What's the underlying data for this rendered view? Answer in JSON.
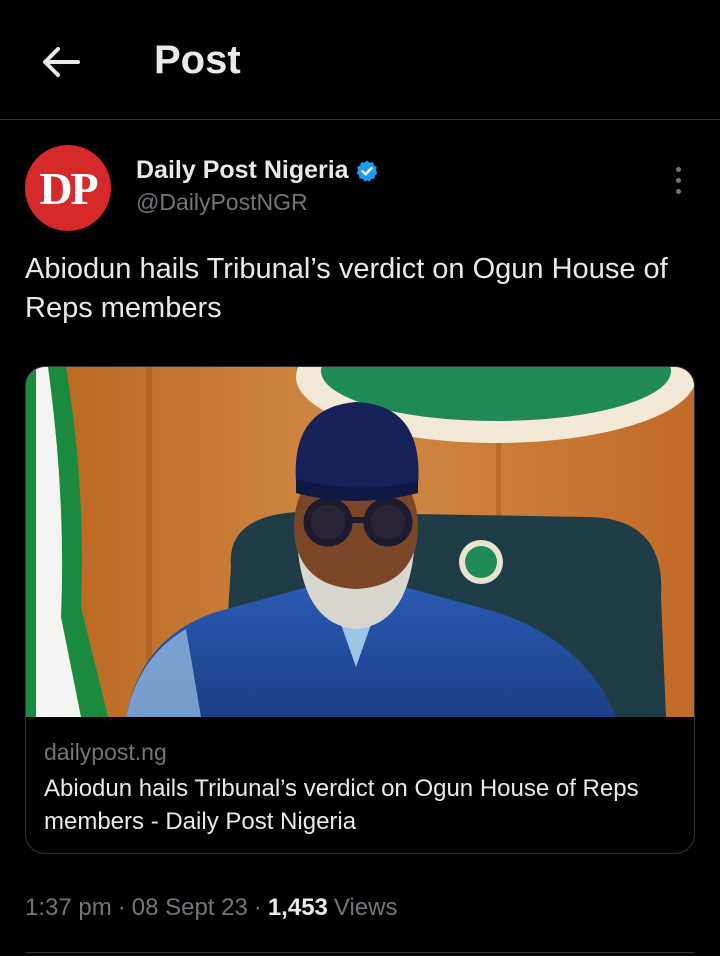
{
  "header": {
    "title": "Post",
    "back_icon": "arrow-left-icon"
  },
  "author": {
    "avatar_text": "DP",
    "avatar_color": "#d62a2a",
    "name": "Daily Post Nigeria",
    "handle": "@DailyPostNGR",
    "verified_color": "#1d9bf0"
  },
  "post": {
    "text": "Abiodun hails Tribunal’s verdict on Ogun House of Reps members"
  },
  "card": {
    "domain": "dailypost.ng",
    "title": "Abiodun hails Tribunal’s verdict on Ogun House of Reps members - Daily Post Nigeria"
  },
  "meta": {
    "time": "1:37 pm",
    "separator": "·",
    "date": "08 Sept 23",
    "views_count": "1,453",
    "views_label": "Views"
  }
}
